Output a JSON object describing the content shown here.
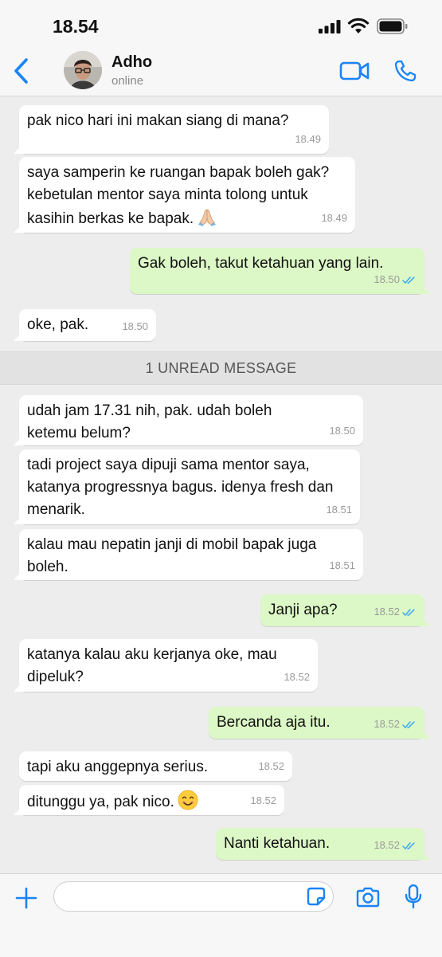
{
  "status_bar": {
    "time": "18.54"
  },
  "header": {
    "contact_name": "Adho",
    "contact_status": "online"
  },
  "unread_label": "1 UNREAD MESSAGE",
  "colors": {
    "accent": "#1a84f6",
    "outgoing_bubble": "#dcf8c6",
    "incoming_bubble": "#ffffff",
    "read_ticks": "#3ba7f0"
  },
  "icons": [
    "back-icon",
    "video-call-icon",
    "phone-call-icon",
    "plus-icon",
    "sticker-icon",
    "camera-icon",
    "microphone-icon",
    "read-receipt-icon"
  ],
  "messages": [
    {
      "dir": "in",
      "text": "pak nico hari ini makan siang di mana?",
      "time": "18.49"
    },
    {
      "dir": "in",
      "text": "saya samperin ke ruangan bapak boleh gak? kebetulan mentor saya minta tolong untuk kasihin berkas ke bapak.",
      "emoji": "folded-hands",
      "time": "18.49"
    },
    {
      "dir": "out",
      "text": "Gak boleh, takut ketahuan yang lain.",
      "time": "18.50",
      "read": true
    },
    {
      "dir": "in",
      "text": "oke, pak.",
      "time": "18.50"
    },
    {
      "dir": "in",
      "text": "udah jam 17.31 nih, pak. udah boleh ketemu belum?",
      "time": "18.50"
    },
    {
      "dir": "in",
      "text": "tadi project saya dipuji sama mentor saya, katanya progressnya bagus. idenya fresh dan menarik.",
      "time": "18.51"
    },
    {
      "dir": "in",
      "text": "kalau mau nepatin janji di mobil bapak juga boleh.",
      "time": "18.51"
    },
    {
      "dir": "out",
      "text": "Janji apa?",
      "time": "18.52",
      "read": true
    },
    {
      "dir": "in",
      "text": "katanya kalau aku kerjanya oke, mau dipeluk?",
      "time": "18.52"
    },
    {
      "dir": "out",
      "text": "Bercanda aja itu.",
      "time": "18.52",
      "read": true
    },
    {
      "dir": "in",
      "text": "tapi aku anggepnya serius.",
      "time": "18.52"
    },
    {
      "dir": "in",
      "text": "ditunggu ya, pak nico.",
      "emoji": "smiling-face",
      "time": "18.52"
    },
    {
      "dir": "out",
      "text": "Nanti ketahuan.",
      "time": "18.52",
      "read": true
    }
  ],
  "input": {
    "placeholder": ""
  }
}
